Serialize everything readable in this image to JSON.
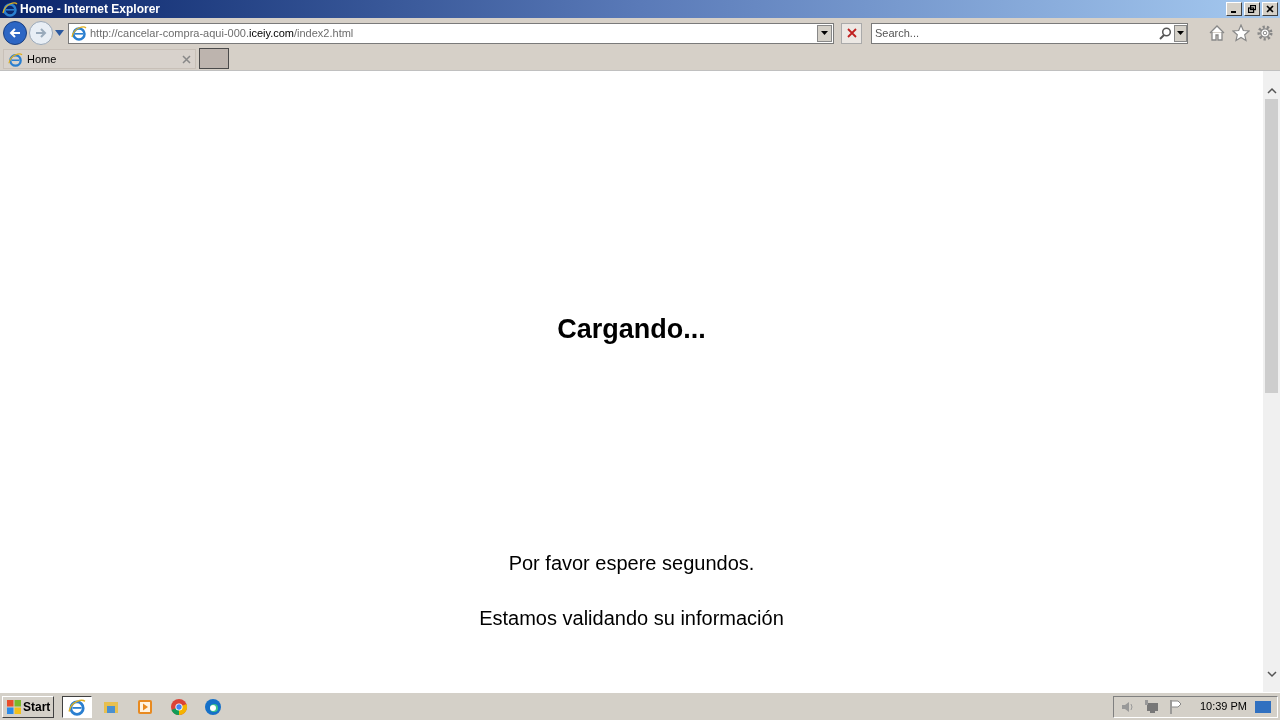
{
  "window": {
    "title": "Home - Internet Explorer"
  },
  "address": {
    "prefix": "http://cancelar-compra-aqui-000.",
    "domain": "iceiy.com",
    "suffix": "/index2.html"
  },
  "search": {
    "placeholder": "Search..."
  },
  "tabs": [
    {
      "label": "Home",
      "selected": true
    }
  ],
  "page": {
    "heading": "Cargando...",
    "lines": [
      "Por favor espere segundos.",
      "Estamos validando su información"
    ]
  },
  "taskbar": {
    "start": "Start",
    "apps": [
      {
        "kind": "ie",
        "selected": true
      },
      {
        "kind": "folder",
        "selected": false
      },
      {
        "kind": "media",
        "selected": false
      },
      {
        "kind": "chrome",
        "selected": false
      },
      {
        "kind": "edge",
        "selected": false
      }
    ],
    "clock": "10:39 PM"
  }
}
